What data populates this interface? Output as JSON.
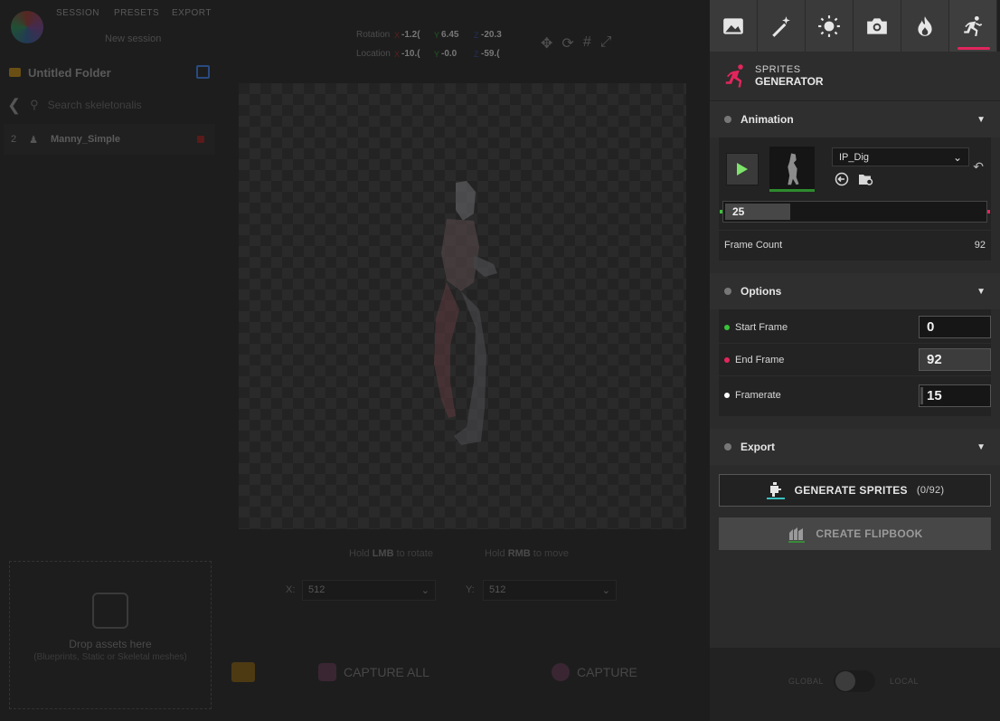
{
  "top_menu": {
    "session": "SESSION",
    "presets": "PRESETS",
    "export": "EXPORT"
  },
  "session_name": "New session",
  "transform": {
    "rotation_label": "Rotation",
    "location_label": "Location",
    "rotation": {
      "x": "-1.2(",
      "y": "6.45",
      "z": "-20.3"
    },
    "location": {
      "x": "-10.(",
      "y": "-0.0",
      "z": "-59.("
    },
    "axis_x": "X",
    "axis_y": "Y",
    "axis_z": "Z"
  },
  "folder": {
    "name": "Untitled Folder"
  },
  "search": {
    "placeholder": "Search skeletonalis"
  },
  "assets": [
    {
      "index": "2",
      "name": "Manny_Simple"
    }
  ],
  "viewport_hints": {
    "lmb_pre": "Hold ",
    "lmb": "LMB",
    "lmb_post": " to rotate",
    "rmb_pre": "Hold ",
    "rmb": "RMB",
    "rmb_post": " to move"
  },
  "size": {
    "x_label": "X:",
    "x_value": "512",
    "y_label": "Y:",
    "y_value": "512"
  },
  "drop_zone": {
    "title": "Drop assets here",
    "subtitle": "(Blueprints, Static or Skeletal meshes)"
  },
  "capture": {
    "all_label": "CAPTURE ALL",
    "single_label": "CAPTURE"
  },
  "space_toggle": {
    "global": "GLOBAL",
    "local": "LOCAL"
  },
  "tabs": [
    "image-icon",
    "magic-wand-icon",
    "sun-icon",
    "camera-icon",
    "fire-icon",
    "running-icon"
  ],
  "panel_header": {
    "line1": "SPRITES",
    "line2": "GENERATOR"
  },
  "animation": {
    "title": "Animation",
    "selected": "IP_Dig",
    "current_frame": "25",
    "frame_progress": 0.25,
    "frame_count_label": "Frame Count",
    "frame_count": "92"
  },
  "options": {
    "title": "Options",
    "start_label": "Start Frame",
    "start_value": "0",
    "end_label": "End Frame",
    "end_value": "92",
    "fps_label": "Framerate",
    "fps_value": "15"
  },
  "export": {
    "title": "Export",
    "generate_label": "GENERATE SPRITES",
    "generate_count": "(0/92)",
    "flipbook_label": "CREATE FLIPBOOK"
  },
  "colors": {
    "accent": "#e2265c",
    "start": "#3ac23a",
    "play": "#7de36a"
  }
}
